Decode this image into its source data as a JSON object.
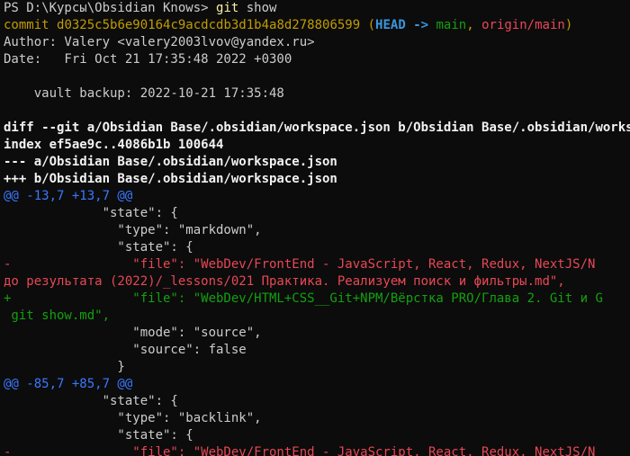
{
  "colors": {
    "background": "#0c0c0c",
    "text": "#cccccc",
    "commit_yellow": "#c19c00",
    "head_cyan": "#3a96dd",
    "branch_green": "#13a10e",
    "origin_red": "#e74856",
    "hunk_blue": "#3b78ff",
    "removed_red": "#e74856",
    "added_green": "#13a10e"
  },
  "prompt": {
    "path": "PS D:\\Курсы\\Obsidian Knows>",
    "command": "git",
    "args": "show"
  },
  "commit": {
    "label": "commit",
    "hash": "d0325c5b6e90164c9acdcdb3d1b4a8d278806599",
    "paren_open": "(",
    "head": "HEAD ->",
    "branch": "main",
    "comma": ",",
    "origin": "origin/main",
    "paren_close": ")"
  },
  "author_line": "Author: Valery <valery2003lvov@yandex.ru>",
  "date_line": "Date:   Fri Oct 21 17:35:48 2022 +0300",
  "message": "    vault backup: 2022-10-21 17:35:48",
  "diff_header": {
    "diff": "diff --git a/Obsidian Base/.obsidian/workspace.json b/Obsidian Base/.obsidian/workspace.json",
    "index": "index ef5ae9c..4086b1b 100644",
    "minus": "--- a/Obsidian Base/.obsidian/workspace.json",
    "plus": "+++ b/Obsidian Base/.obsidian/workspace.json"
  },
  "hunk1": {
    "header": "@@ -13,7 +13,7 @@",
    "lines": [
      {
        "type": "context",
        "text": "             \"state\": {"
      },
      {
        "type": "context",
        "text": "               \"type\": \"markdown\","
      },
      {
        "type": "context",
        "text": "               \"state\": {"
      },
      {
        "type": "removed",
        "text": "-                \"file\": \"WebDev/FrontEnd - JavaScript, React, Redux, NextJS/N"
      },
      {
        "type": "removed",
        "text": "до результата (2022)/_lessons/021 Практика. Реализуем поиск и фильтры.md\","
      },
      {
        "type": "added",
        "text": "+                \"file\": \"WebDev/HTML+CSS__Git+NPM/Вёрстка PRO/Глава 2. Git и G"
      },
      {
        "type": "added",
        "text": " git show.md\","
      },
      {
        "type": "context",
        "text": "                 \"mode\": \"source\","
      },
      {
        "type": "context",
        "text": "                 \"source\": false"
      },
      {
        "type": "context",
        "text": "               }"
      }
    ]
  },
  "hunk2": {
    "header": "@@ -85,7 +85,7 @@",
    "lines": [
      {
        "type": "context",
        "text": "             \"state\": {"
      },
      {
        "type": "context",
        "text": "               \"type\": \"backlink\","
      },
      {
        "type": "context",
        "text": "               \"state\": {"
      },
      {
        "type": "removed",
        "text": "-                \"file\": \"WebDev/FrontEnd - JavaScript, React, Redux, NextJS/N"
      }
    ]
  }
}
